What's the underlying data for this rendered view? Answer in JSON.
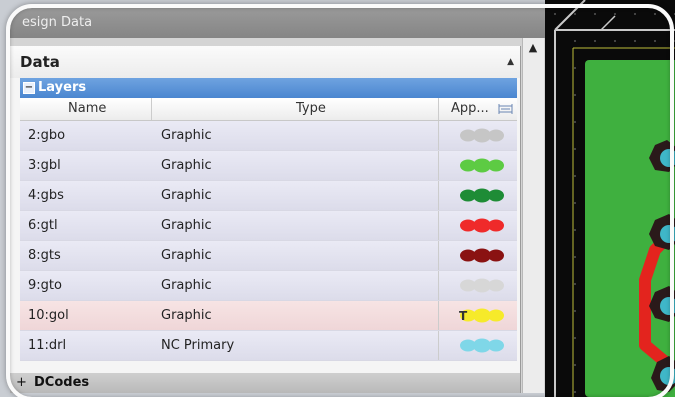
{
  "panel": {
    "title": "esign Data",
    "data_header": "Data",
    "collapse_icon": "triangle-up-icon",
    "layers_section": {
      "toggle": "−",
      "label": "Layers",
      "columns": {
        "name": "Name",
        "type": "Type",
        "app": "App..."
      },
      "rows": [
        {
          "name": "2:gbo",
          "type": "Graphic",
          "color": "#c6c6c6"
        },
        {
          "name": "3:gbl",
          "type": "Graphic",
          "color": "#5dcb43"
        },
        {
          "name": "4:gbs",
          "type": "Graphic",
          "color": "#1e8c36"
        },
        {
          "name": "6:gtl",
          "type": "Graphic",
          "color": "#ef2a2a"
        },
        {
          "name": "8:gts",
          "type": "Graphic",
          "color": "#8a1212"
        },
        {
          "name": "9:gto",
          "type": "Graphic",
          "color": "#d7d7d7"
        },
        {
          "name": "10:gol",
          "type": "Graphic",
          "color": "#f6ea2a",
          "selected": true
        },
        {
          "name": "11:drl",
          "type": "NC Primary",
          "color": "#7fd7e8"
        }
      ]
    },
    "dcodes_section": {
      "toggle": "+",
      "label": "DCodes"
    }
  },
  "scrollbar": {
    "up_icon": "triangle-up-icon"
  },
  "pcb": {
    "background": "#0a0a0a",
    "board_color": "#3fb03f",
    "trace_color": "#e3241e",
    "pad_color": "#2a1a1a",
    "hole_color": "#3fb7c8"
  }
}
